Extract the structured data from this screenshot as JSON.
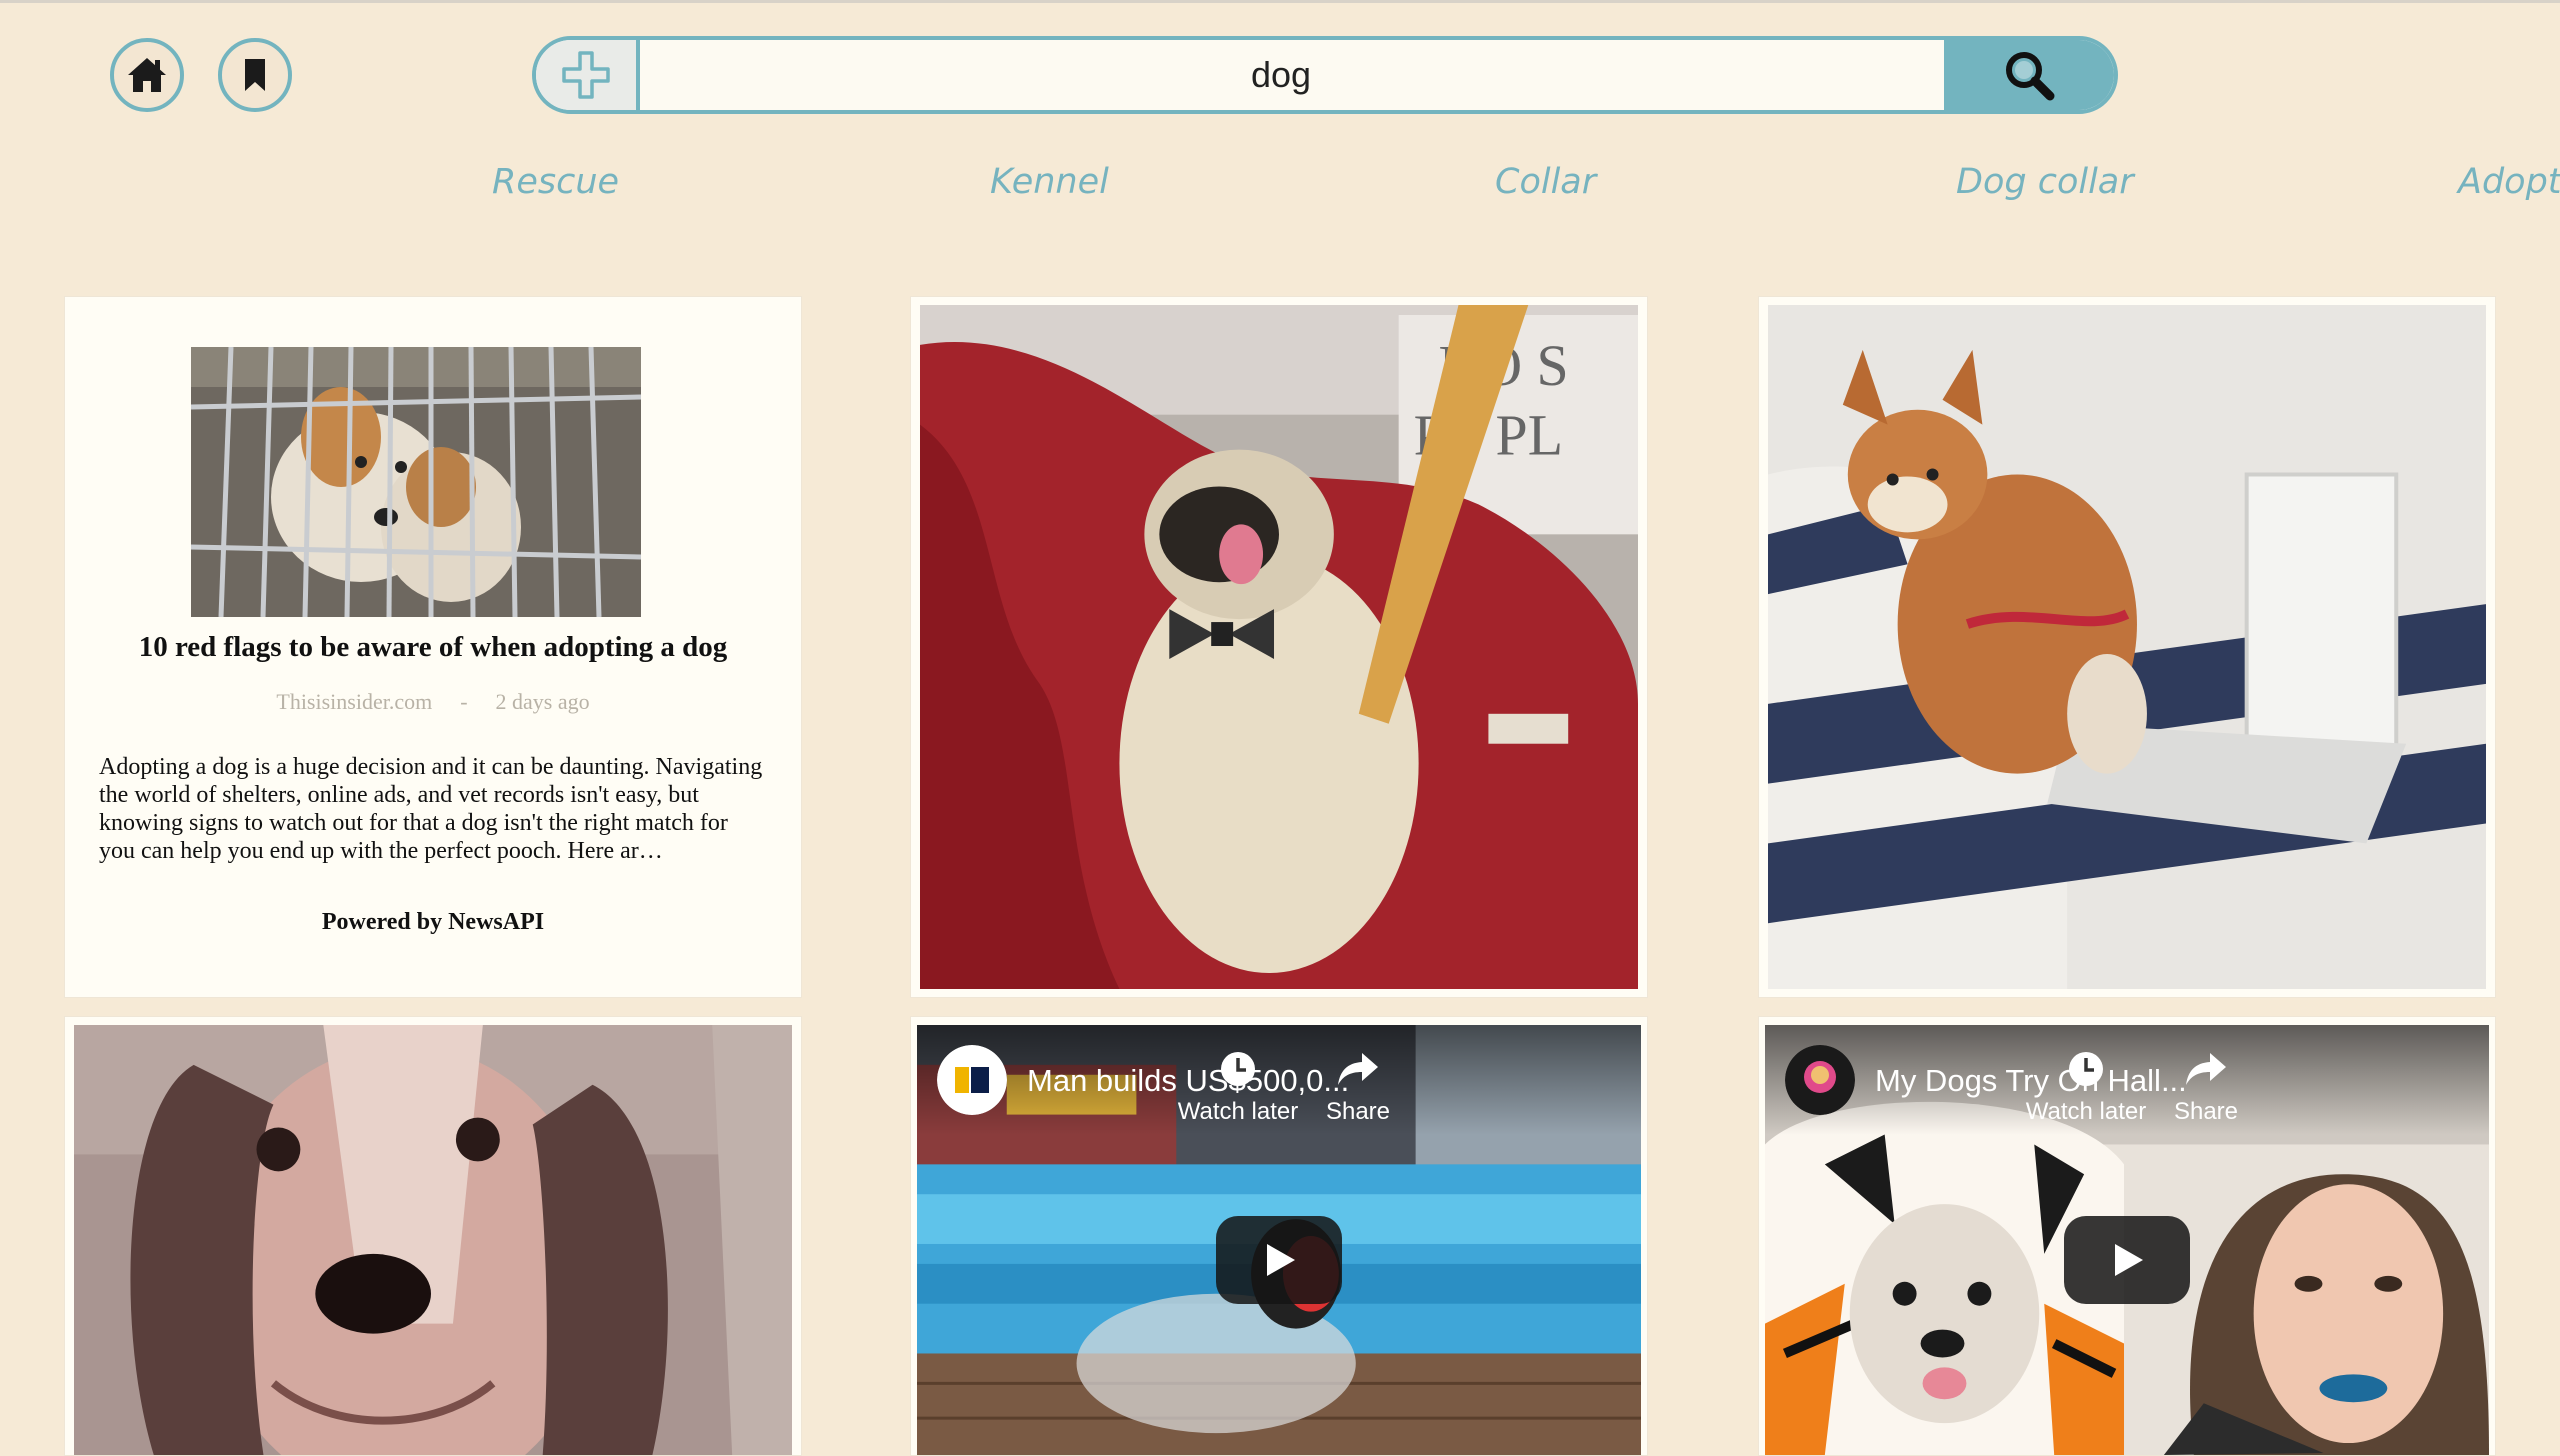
{
  "nav": {
    "home_icon": "home-icon",
    "bookmark_icon": "bookmark-icon"
  },
  "search": {
    "value": "dog",
    "add_icon": "plus-icon",
    "search_icon": "magnifier-icon"
  },
  "suggestions": [
    "Rescue",
    "Kennel",
    "Collar",
    "Dog collar",
    "Adopt"
  ],
  "news_card": {
    "title": "10 red flags to be aware of when adopting a dog",
    "source": "Thisisinsider.com",
    "separator": "-",
    "time": "2 days ago",
    "description": "Adopting a dog is a huge decision and it can be daunting. Navigating the world of shelters, online ads, and vet records isn't easy, but knowing signs to watch out for that a dog isn't the right match for you can help you end up with the perfect pooch. Here ar…",
    "powered_by": "Powered by NewsAPI"
  },
  "videos": [
    {
      "title": "Man builds US$500,0...",
      "watch_later": "Watch later",
      "share": "Share"
    },
    {
      "title": "My Dogs Try On Hall...",
      "watch_later": "Watch later",
      "share": "Share"
    }
  ],
  "colors": {
    "background": "#f6ead6",
    "accent": "#73b4bf",
    "card": "#fffdf5",
    "suggestion_text": "#76b3bf"
  }
}
